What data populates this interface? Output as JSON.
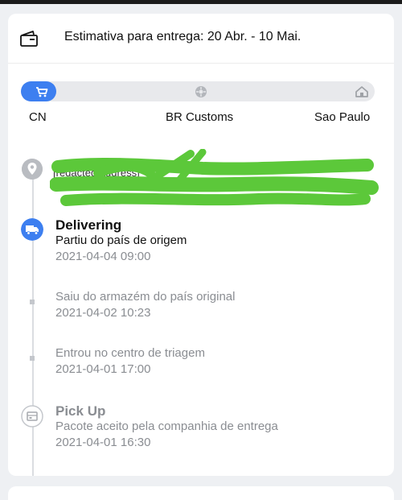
{
  "delivery": {
    "estimate": "Estimativa para entrega: 20 Abr. - 10 Mai."
  },
  "progress": {
    "fraction": 0.1,
    "active_color": "#3d7ff0",
    "nodes": [
      "cart-icon",
      "customs-icon",
      "home-icon"
    ]
  },
  "stages": [
    "CN",
    "BR Customs",
    "Sao Paulo"
  ],
  "address": {
    "text": "[redacted address]",
    "redaction_color": "#5cc83a"
  },
  "events": [
    {
      "title": "Delivering",
      "description": "Partiu do país de origem",
      "time": "2021-04-04 09:00",
      "icon": "truck-icon",
      "active": true
    },
    {
      "title": "",
      "description": "Saiu do armazém do país original",
      "time": "2021-04-02 10:23",
      "icon": "",
      "active": false
    },
    {
      "title": "",
      "description": "Entrou no centro de triagem",
      "time": "2021-04-01 17:00",
      "icon": "",
      "active": false
    },
    {
      "title": "Pick Up",
      "description": "Pacote aceito pela companhia de entrega",
      "time": "2021-04-01 16:30",
      "icon": "package-icon",
      "active": false
    }
  ]
}
